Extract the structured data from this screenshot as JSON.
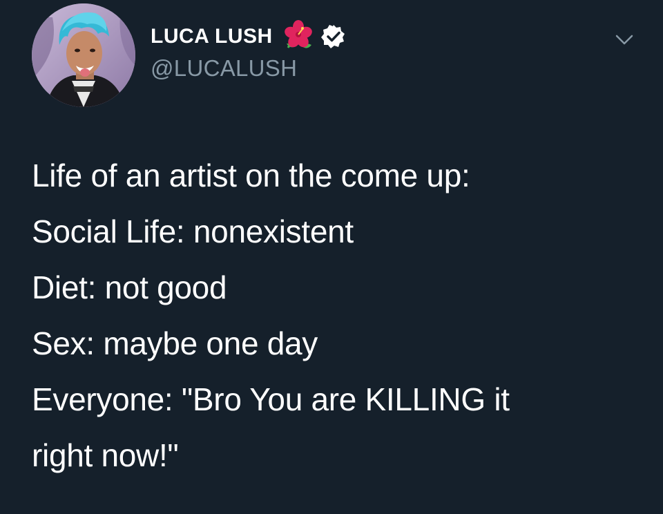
{
  "tweet": {
    "author": {
      "display_name": "LUCA LUSH",
      "handle": "@LUCALUSH",
      "badges": [
        "hibiscus-flower-emoji",
        "verified-badge-icon"
      ],
      "avatar": "profile-photo-blue-hair"
    },
    "menu_icon": "chevron-down-icon",
    "lines": [
      "Life of an artist on the come up:",
      "Social Life: nonexistent",
      "Diet: not good",
      "Sex: maybe one day",
      "Everyone: \"Bro You are KILLING it",
      "right now!\""
    ]
  },
  "colors": {
    "background": "#15202b",
    "text": "#ffffff",
    "handle": "#8899a6",
    "verified_badge": "#ffffff",
    "flower": "#e0245e"
  }
}
